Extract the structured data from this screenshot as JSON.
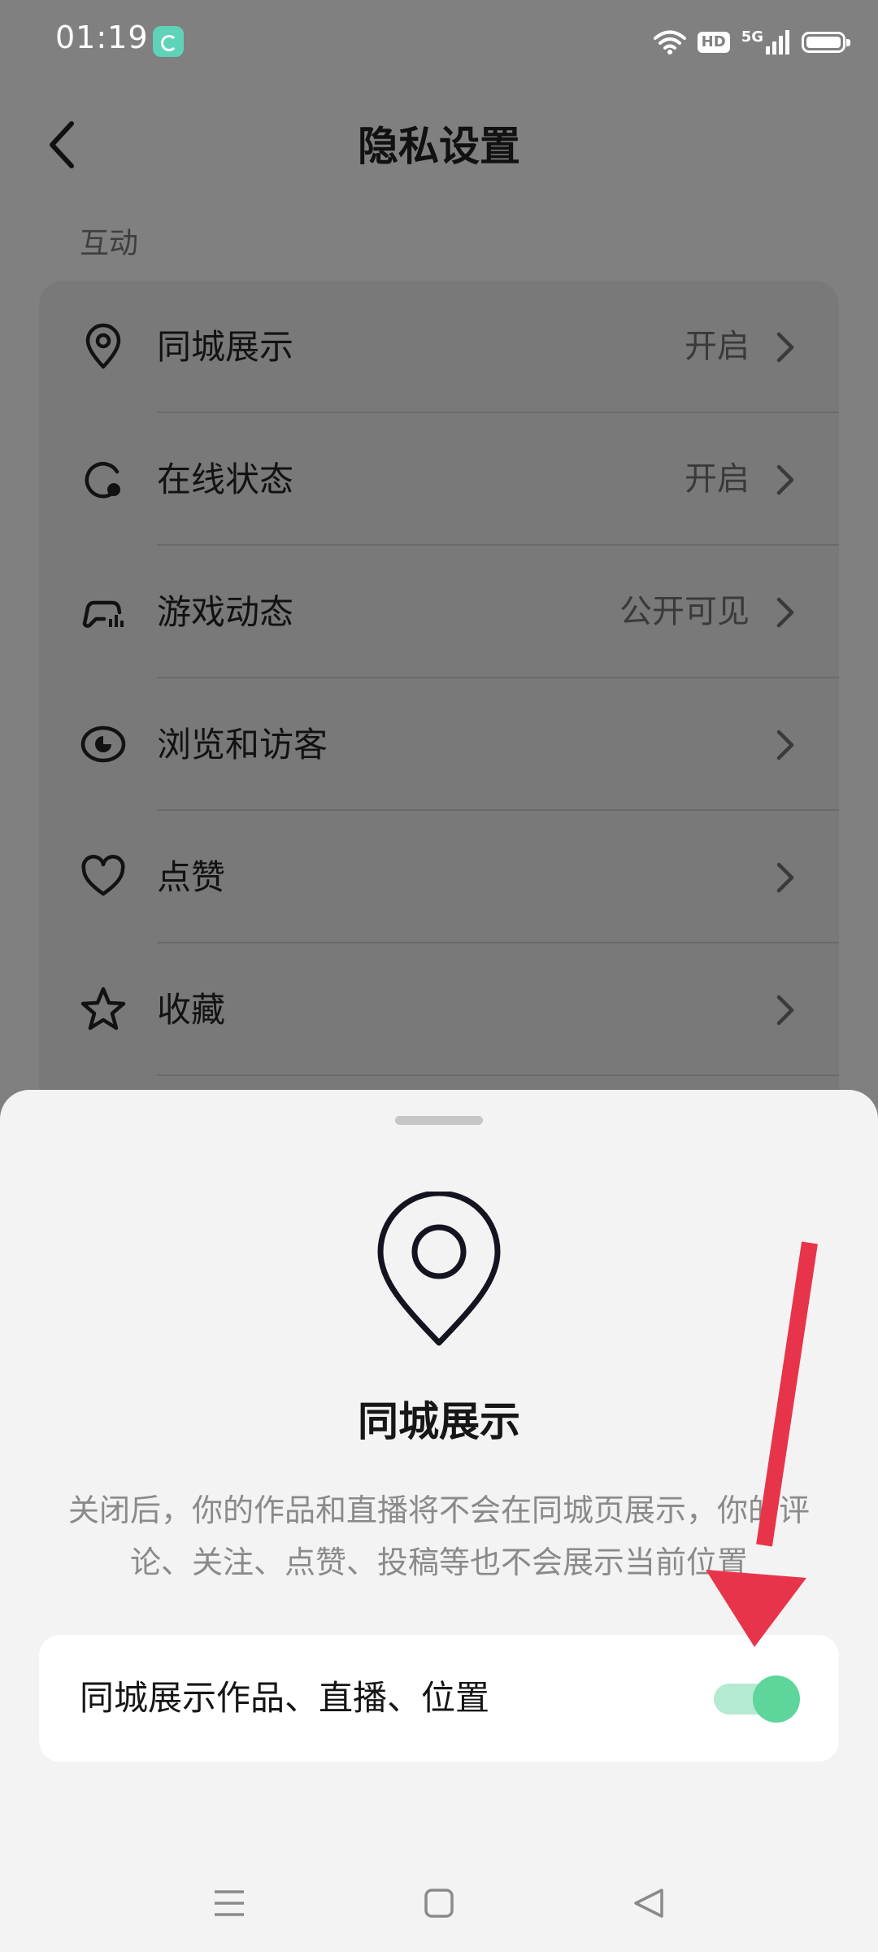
{
  "status_bar": {
    "time": "01:19",
    "hd_label": "HD",
    "network_label": "5G"
  },
  "header": {
    "title": "隐私设置"
  },
  "section": {
    "label": "互动"
  },
  "settings_items": [
    {
      "icon": "location-pin-icon",
      "label": "同城展示",
      "value": "开启"
    },
    {
      "icon": "online-status-icon",
      "label": "在线状态",
      "value": "开启"
    },
    {
      "icon": "gamepad-icon",
      "label": "游戏动态",
      "value": "公开可见"
    },
    {
      "icon": "eye-icon",
      "label": "浏览和访客",
      "value": ""
    },
    {
      "icon": "heart-icon",
      "label": "点赞",
      "value": ""
    },
    {
      "icon": "star-icon",
      "label": "收藏",
      "value": ""
    }
  ],
  "sheet": {
    "title": "同城展示",
    "description": "关闭后，你的作品和直播将不会在同城页展示，你的评论、关注、点赞、投稿等也不会展示当前位置",
    "toggle_label": "同城展示作品、直播、位置",
    "toggle_on": true
  },
  "colors": {
    "accent_green": "#5dd59b",
    "annotation_red": "#e8344a"
  }
}
